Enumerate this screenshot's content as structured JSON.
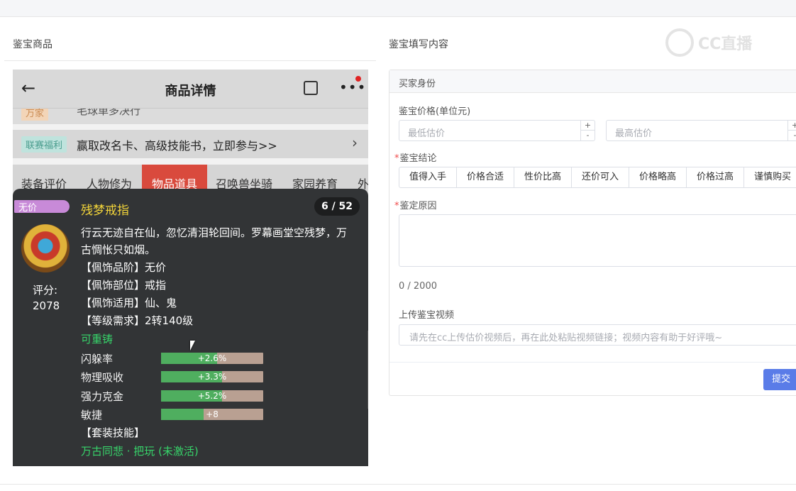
{
  "left_section": {
    "title": "鉴宝商品"
  },
  "right_section": {
    "title": "鉴宝填写内容"
  },
  "watermark": {
    "text": "CC直播"
  },
  "phone": {
    "header": {
      "title": "商品详情",
      "back_icon": "arrow-left-icon",
      "share_icon": "share-icon",
      "more_icon": "more-icon"
    },
    "clipped_row": {
      "tag": "万家",
      "text": "毛球单多决行"
    },
    "promo": {
      "tag": "联赛福利",
      "text": "赢取改名卡、高级技能书，立即参与>>"
    },
    "tabs": [
      "装备评价",
      "人物修为",
      "物品道具",
      "召唤兽坐骑",
      "家园养育",
      "外"
    ],
    "active_tab": "物品道具"
  },
  "item": {
    "badge": "无价",
    "name": "残梦戒指",
    "counter": "6 / 52",
    "score_label": "评分:",
    "score_value": "2078",
    "description": "行云无迹自在仙，忽忆清泪轮回间。罗幕画堂空残梦，万古惆怅只如烟。",
    "attrs": [
      "【佩饰品阶】无价",
      "【佩饰部位】戒指",
      "【佩饰适用】仙、鬼",
      "【等级需求】2转140级"
    ],
    "reforge": "可重铸",
    "stats": [
      {
        "label": "闪躲率",
        "value": "+2.6%",
        "fill": 0.55
      },
      {
        "label": "物理吸收",
        "value": "+3.3%",
        "fill": 0.6
      },
      {
        "label": "强力克金",
        "value": "+5.2%",
        "fill": 0.6
      },
      {
        "label": "敏捷",
        "value": "+8",
        "fill": 0.42
      }
    ],
    "set_skill_label": "【套装技能】",
    "set_skill_name": "万古同悲 · 把玩 (未激活)"
  },
  "form": {
    "header": "买家身份",
    "price_label": "鉴宝价格(单位元)",
    "min_placeholder": "最低估价",
    "max_placeholder": "最高估价",
    "conclusion_label": "鉴宝结论",
    "conclusions": [
      "值得入手",
      "价格合适",
      "性价比高",
      "还价可入",
      "价格略高",
      "价格过高",
      "谨慎购买"
    ],
    "reason_label": "鉴定原因",
    "reason_counter": "0 / 2000",
    "video_label": "上传鉴宝视频",
    "video_placeholder": "请先在cc上传估价视频后，再在此处粘贴视频链接；视频内容有助于好评哦~",
    "submit": "提交"
  }
}
